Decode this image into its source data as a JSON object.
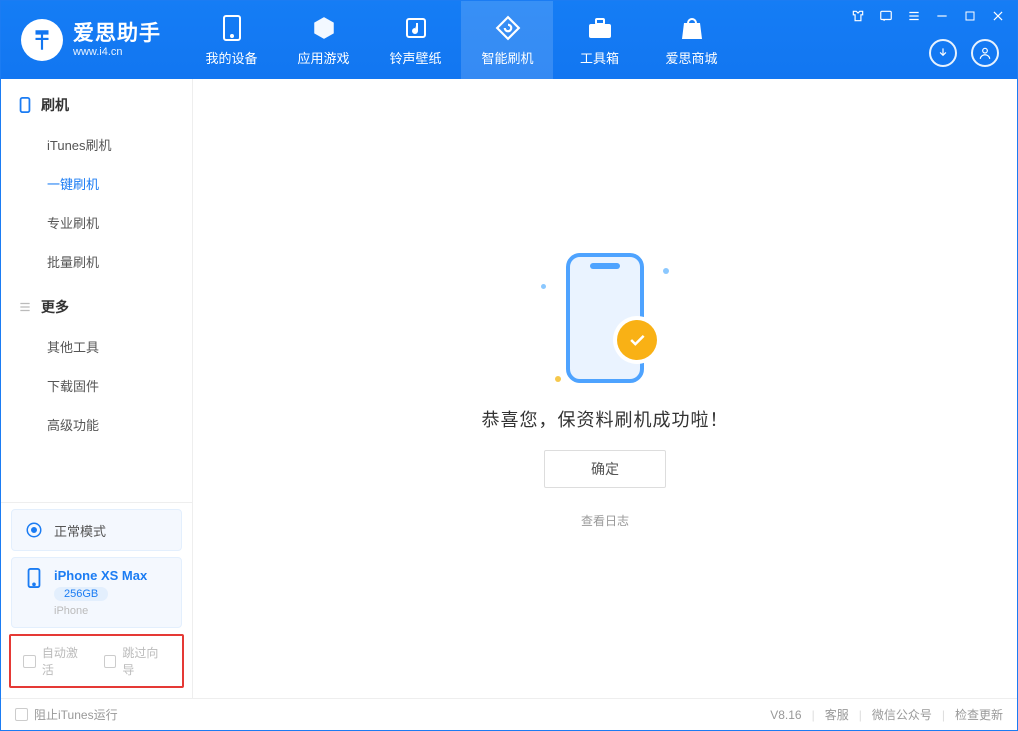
{
  "titlebar": {
    "app_name": "爱思助手",
    "url": "www.i4.cn"
  },
  "tabs": [
    {
      "label": "我的设备",
      "icon": "device-icon"
    },
    {
      "label": "应用游戏",
      "icon": "cube-icon"
    },
    {
      "label": "铃声壁纸",
      "icon": "music-icon"
    },
    {
      "label": "智能刷机",
      "icon": "refresh-icon",
      "active": true
    },
    {
      "label": "工具箱",
      "icon": "toolbox-icon"
    },
    {
      "label": "爱思商城",
      "icon": "bag-icon"
    }
  ],
  "sidebar": {
    "section1": {
      "title": "刷机",
      "items": [
        "iTunes刷机",
        "一键刷机",
        "专业刷机",
        "批量刷机"
      ],
      "active_index": 1
    },
    "section2": {
      "title": "更多",
      "items": [
        "其他工具",
        "下载固件",
        "高级功能"
      ]
    }
  },
  "mode": {
    "label": "正常模式"
  },
  "device": {
    "name": "iPhone XS Max",
    "storage": "256GB",
    "subtype": "iPhone"
  },
  "checkboxes": {
    "auto_activate": "自动激活",
    "skip_guide": "跳过向导"
  },
  "main": {
    "message": "恭喜您，保资料刷机成功啦！",
    "ok": "确定",
    "view_log": "查看日志"
  },
  "statusbar": {
    "block_itunes": "阻止iTunes运行",
    "version": "V8.16",
    "cs": "客服",
    "wechat": "微信公众号",
    "update": "检查更新"
  }
}
